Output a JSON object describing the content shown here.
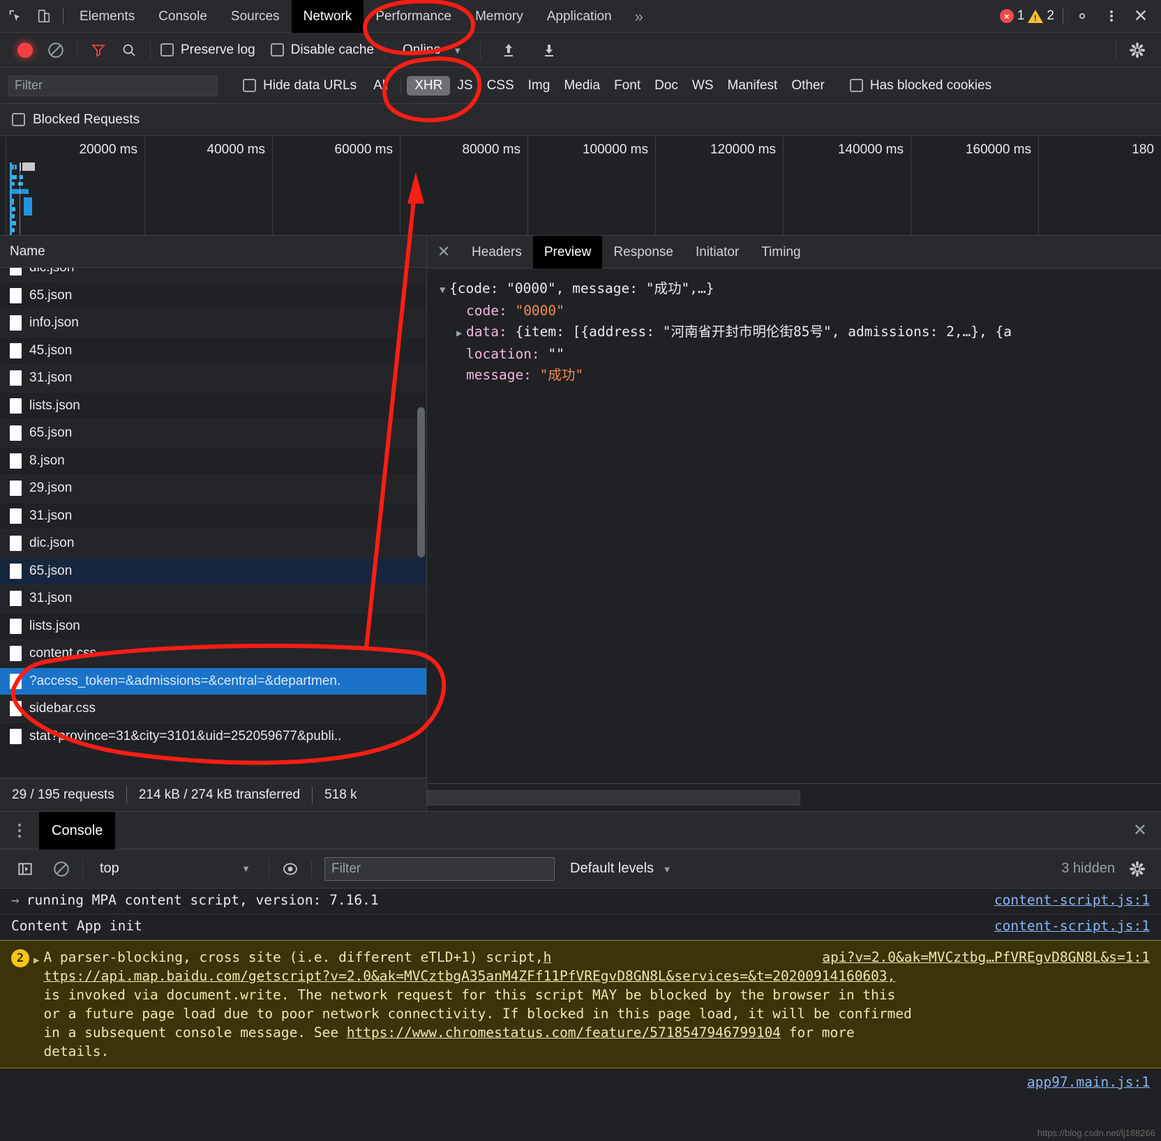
{
  "tabbar": {
    "icons": [
      "inspect-icon",
      "device-toolbar-icon"
    ],
    "tabs": [
      {
        "label": "Elements",
        "active": false
      },
      {
        "label": "Console",
        "active": false
      },
      {
        "label": "Sources",
        "active": false
      },
      {
        "label": "Network",
        "active": true
      },
      {
        "label": "Performance",
        "active": false
      },
      {
        "label": "Memory",
        "active": false
      },
      {
        "label": "Application",
        "active": false
      }
    ],
    "more": "»",
    "error_count": "1",
    "warning_count": "2",
    "error_glyph": "×",
    "close_glyph": "✕"
  },
  "network_toolbar": {
    "preserve_log": "Preserve log",
    "disable_cache": "Disable cache",
    "throttling": "Online",
    "caret": "▼",
    "import_icon": "upload-arrow-icon",
    "export_icon": "download-arrow-icon"
  },
  "filter_bar": {
    "filter_placeholder": "Filter",
    "hide_data_urls": "Hide data URLs",
    "types": [
      {
        "label": "All",
        "selected": false
      },
      {
        "label": "XHR",
        "selected": true
      },
      {
        "label": "JS",
        "selected": false
      },
      {
        "label": "CSS",
        "selected": false
      },
      {
        "label": "Img",
        "selected": false
      },
      {
        "label": "Media",
        "selected": false
      },
      {
        "label": "Font",
        "selected": false
      },
      {
        "label": "Doc",
        "selected": false
      },
      {
        "label": "WS",
        "selected": false
      },
      {
        "label": "Manifest",
        "selected": false
      },
      {
        "label": "Other",
        "selected": false
      }
    ],
    "has_blocked_cookies": "Has blocked cookies",
    "blocked_requests": "Blocked Requests"
  },
  "overview": {
    "ticks": [
      "20000 ms",
      "40000 ms",
      "60000 ms",
      "80000 ms",
      "100000 ms",
      "120000 ms",
      "140000 ms",
      "160000 ms",
      "180"
    ]
  },
  "request_table": {
    "column_header": "Name",
    "rows": [
      {
        "name": "dic.json",
        "state": "partial"
      },
      {
        "name": "65.json",
        "state": "normal"
      },
      {
        "name": "info.json",
        "state": "normal"
      },
      {
        "name": "45.json",
        "state": "normal"
      },
      {
        "name": "31.json",
        "state": "normal"
      },
      {
        "name": "lists.json",
        "state": "normal"
      },
      {
        "name": "65.json",
        "state": "normal"
      },
      {
        "name": "8.json",
        "state": "normal"
      },
      {
        "name": "29.json",
        "state": "normal"
      },
      {
        "name": "31.json",
        "state": "normal"
      },
      {
        "name": "dic.json",
        "state": "normal"
      },
      {
        "name": "65.json",
        "state": "highlighted"
      },
      {
        "name": "31.json",
        "state": "normal"
      },
      {
        "name": "lists.json",
        "state": "normal"
      },
      {
        "name": "content.css",
        "state": "normal"
      },
      {
        "name": "?access_token=&admissions=&central=&departmen.",
        "state": "selected"
      },
      {
        "name": "sidebar.css",
        "state": "normal"
      },
      {
        "name": "stat?province=31&city=3101&uid=252059677&publi..",
        "state": "normal"
      }
    ],
    "summary": {
      "requests": "29 / 195 requests",
      "transferred": "214 kB / 274 kB transferred",
      "resources": "518 k"
    }
  },
  "detail_panel": {
    "close_glyph": "✕",
    "tabs": [
      {
        "label": "Headers",
        "active": false
      },
      {
        "label": "Preview",
        "active": true
      },
      {
        "label": "Response",
        "active": false
      },
      {
        "label": "Initiator",
        "active": false
      },
      {
        "label": "Timing",
        "active": false
      }
    ],
    "preview": {
      "line1_tri": "▼",
      "line1": "{code: \"0000\", message: \"成功\",…}",
      "line2_key": "code:",
      "line2_val": "\"0000\"",
      "line3_tri": "▶",
      "line3_key": "data:",
      "line3_val": "{item: [{address: \"河南省开封市明伦街85号\", admissions: 2,…}, {a",
      "line4_key": "location:",
      "line4_val": "\"\"",
      "line5_key": "message:",
      "line5_val": "\"成功\""
    }
  },
  "drawer": {
    "tab_label": "Console",
    "close_glyph": "✕",
    "toolbar": {
      "execute_icon": "execute-sidebar-icon",
      "clear_icon": "clear-console-icon",
      "context": "top",
      "caret": "▼",
      "eye_icon": "live-expression-icon",
      "filter_placeholder": "Filter",
      "levels": "Default levels",
      "levels_caret": "▼",
      "hidden": "3 hidden",
      "settings_icon": "gear-icon"
    },
    "messages": [
      {
        "type": "log",
        "prefix": "→",
        "text": "running MPA content script, version: 7.16.1",
        "source": "content-script.js:1"
      },
      {
        "type": "log",
        "prefix": "",
        "text": "Content App init",
        "source": "content-script.js:1"
      },
      {
        "type": "warning",
        "badge": "2",
        "arrow": "▶",
        "line1_a": "A parser-blocking, cross site (i.e. different eTLD+1) script, ",
        "line1_link_head": "h",
        "line1_right": "api?v=2.0&ak=MVCztbg…PfVREgvD8GN8L&s=1:1",
        "line2": "ttps://api.map.baidu.com/getscript?v=2.0&ak=MVCztbgA35anM4ZFf11PfVREgvD8GN8L&services=&t=20200914160603,",
        "line3": "is invoked via document.write. The network request for this script MAY be blocked by the browser in this",
        "line4": "or a future page load due to poor network connectivity. If blocked in this page load, it will be confirmed",
        "line5_a": "in a subsequent console message. See ",
        "line5_link": "https://www.chromestatus.com/feature/5718547946799104",
        "line5_b": " for more",
        "line6": "details.",
        "source": "app97.main.js:1"
      }
    ]
  },
  "watermark": "https://blog.csdn.net/lj188266",
  "colors": {
    "accent_blue": "#1a73c8",
    "selected_row": "#1a73c8",
    "highlight_row": "#16263d",
    "annotation_red": "#fa1e14",
    "warning_bg": "#3b3409",
    "link_blue": "#8ab4f8"
  }
}
